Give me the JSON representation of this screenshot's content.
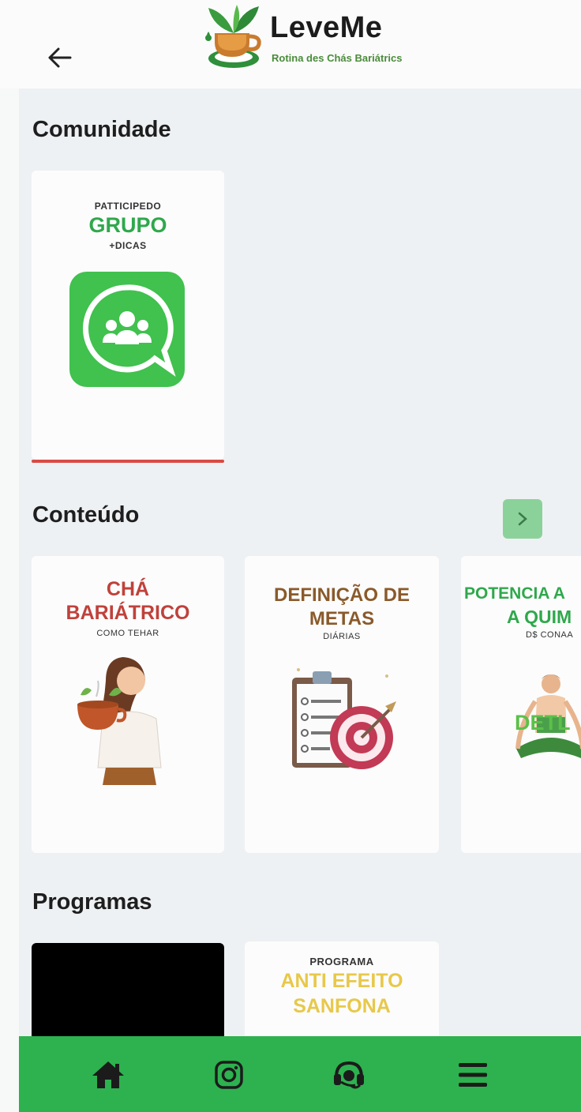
{
  "header": {
    "app_name": "LeveMe",
    "tagline": "Rotina des Chás Bariátrics",
    "back_icon": "arrow-left-icon"
  },
  "sections": {
    "comunidade": {
      "title": "Comunidade",
      "card": {
        "small_top": "PATTICIPEDO",
        "big": "GRUPO",
        "small_bottom": "+DICAS",
        "icon": "whatsapp-group-icon"
      }
    },
    "conteudo": {
      "title": "Conteúdo",
      "next_icon": "chevron-right-icon",
      "cards": [
        {
          "line1": "CHÁ",
          "line2": "BARIÁTRICO",
          "sub": "COMO TEHAR",
          "illustration": "woman-with-tea-cup"
        },
        {
          "line1": "DEFINIÇÃO DE",
          "line2": "METAS",
          "sub": "DIÁRIAS",
          "illustration": "clipboard-and-target"
        },
        {
          "line1": "POTENCIA A",
          "line2": "A QUIM",
          "sub": "D$ CONAA",
          "overlay": "DETL",
          "illustration": "woman-meditating"
        }
      ]
    },
    "programas": {
      "title": "Programas",
      "cards": [
        {
          "type": "video-thumbnail-black"
        },
        {
          "small": "PROGRAMA",
          "line1": "ANTI EFEITO",
          "line2": "SANFONA"
        }
      ]
    }
  },
  "bottom_nav": [
    {
      "name": "home",
      "icon": "home-icon"
    },
    {
      "name": "instagram",
      "icon": "instagram-icon"
    },
    {
      "name": "support",
      "icon": "headset-icon"
    },
    {
      "name": "menu",
      "icon": "menu-icon"
    }
  ],
  "colors": {
    "brand_green": "#2db24f",
    "whatsapp_green": "#41c14e",
    "accent_red": "#c0413b",
    "title_brown": "#8a5a2b",
    "title_yellow": "#e8c84a",
    "underline_red": "#d94a45"
  }
}
